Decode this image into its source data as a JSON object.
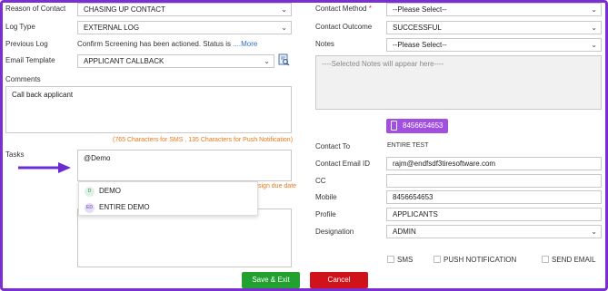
{
  "left": {
    "reason_label": "Reason of Contact",
    "reason_value": "CHASING UP CONTACT",
    "logtype_label": "Log Type",
    "logtype_value": "EXTERNAL LOG",
    "prevlog_label": "Previous Log",
    "prevlog_text": "Confirm Screening has been actioned. Status is",
    "prevlog_more": "....More",
    "template_label": "Email Template",
    "template_value": "APPLICANT CALLBACK",
    "comments_label": "Comments",
    "comments_value": "Call back applicant",
    "char_counter": "(765 Characters for SMS , 135 Characters for Push Notification)",
    "tasks_label": "Tasks",
    "tasks_value": "@Demo",
    "due_date_hint": "sign due date",
    "mention_options": [
      {
        "initials": "D",
        "name": "DEMO"
      },
      {
        "initials": "ED",
        "name": "ENTIRE DEMO"
      }
    ]
  },
  "right": {
    "method_label": "Contact Method",
    "method_required": "*",
    "method_value": "--Please Select--",
    "outcome_label": "Contact Outcome",
    "outcome_value": "SUCCESSFUL",
    "notes_label": "Notes",
    "notes_value": "--Please Select--",
    "notes_placeholder": "----Selected Notes will appear here----",
    "phone_badge": "8456654653",
    "contact_to_label": "Contact To",
    "contact_to_value": "ENTIRE TEST",
    "email_id_label": "Contact Email ID",
    "email_id_value": "rajm@endfsdf3tiresoftware.com",
    "cc_label": "CC",
    "cc_value": "",
    "mobile_label": "Mobile",
    "mobile_value": "8456654653",
    "profile_label": "Profile",
    "profile_value": "APPLICANTS",
    "designation_label": "Designation",
    "designation_value": "ADMIN",
    "sms_label": "SMS",
    "push_label": "PUSH NOTIFICATION",
    "sendemail_label": "SEND EMAIL"
  },
  "buttons": {
    "save_label": "Save & Exit",
    "cancel_label": "Cancel"
  },
  "icons": {
    "caret": "chevron-down-icon",
    "template_preview": "preview-search-icon",
    "phone": "mobile-phone-icon",
    "arrow": "arrow-right-icon"
  },
  "colors": {
    "frame": "#7a2fd0",
    "phone_badge": "#a14fe0",
    "save_button": "#22a030",
    "cancel_button": "#d0131b",
    "counter_text": "#e8781a",
    "arrow": "#6a2bd0"
  }
}
